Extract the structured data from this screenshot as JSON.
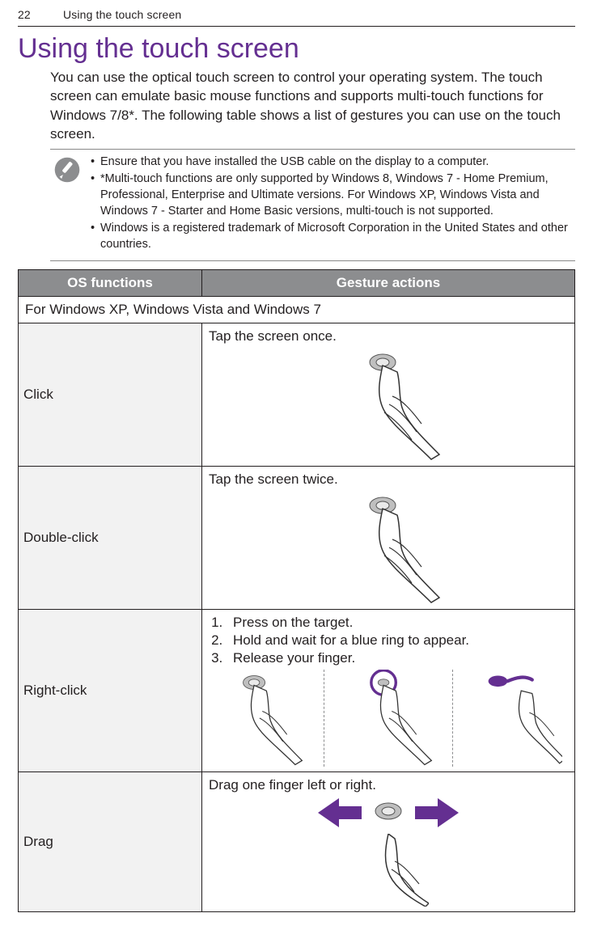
{
  "runningHeader": {
    "pageNumber": "22",
    "sectionTitle": "Using the touch screen"
  },
  "heading": "Using the touch screen",
  "introParagraph": "You can use the optical touch screen to control your operating system. The touch screen can emulate basic mouse functions and supports multi-touch functions for Windows 7/8*. The following table shows a list of gestures you can use on the touch screen.",
  "notes": {
    "items": [
      "Ensure that you have installed the USB cable on the display to a computer.",
      "*Multi-touch functions are only supported by Windows 8, Windows 7 - Home Premium, Professional, Enterprise and Ultimate versions. For Windows XP, Windows Vista and Windows 7 - Starter and Home Basic versions, multi-touch is not supported.",
      "Windows is a registered trademark of Microsoft Corporation in the United States and other countries."
    ]
  },
  "table": {
    "headers": {
      "os": "OS functions",
      "gesture": "Gesture actions"
    },
    "sectionTitle": "For Windows XP, Windows Vista and Windows 7",
    "rows": [
      {
        "os": "Click",
        "gestureText": "Tap the screen once.",
        "type": "single"
      },
      {
        "os": "Double-click",
        "gestureText": "Tap the screen twice.",
        "type": "single"
      },
      {
        "os": "Right-click",
        "steps": [
          "Press on the target.",
          "Hold and wait for a blue ring to appear.",
          "Release your finger."
        ],
        "type": "triple"
      },
      {
        "os": "Drag",
        "gestureText": "Drag one finger left or right.",
        "type": "drag"
      }
    ]
  }
}
